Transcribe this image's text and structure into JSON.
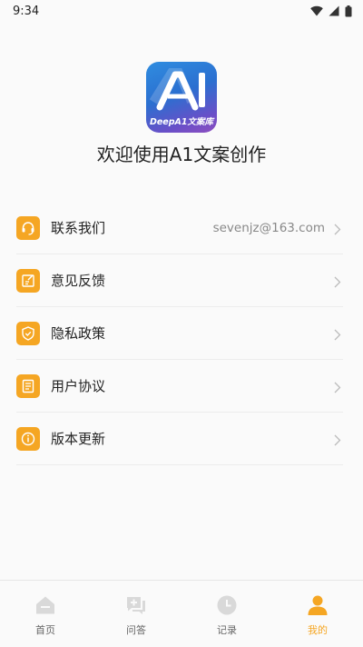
{
  "status_bar": {
    "time": "9:34",
    "icons": [
      "wifi-icon",
      "signal-icon",
      "battery-icon"
    ]
  },
  "app": {
    "logo_text": "DeepA1文案库",
    "welcome": "欢迎使用A1文案创作"
  },
  "menu": {
    "items": [
      {
        "label": "联系我们",
        "value": "sevenjz@163.com",
        "icon": "headset-icon"
      },
      {
        "label": "意见反馈",
        "value": "",
        "icon": "feedback-edit-icon"
      },
      {
        "label": "隐私政策",
        "value": "",
        "icon": "shield-check-icon"
      },
      {
        "label": "用户协议",
        "value": "",
        "icon": "document-icon"
      },
      {
        "label": "版本更新",
        "value": "",
        "icon": "info-icon"
      }
    ]
  },
  "tabs": [
    {
      "label": "首页",
      "icon": "home-icon",
      "active": false
    },
    {
      "label": "问答",
      "icon": "chat-plus-icon",
      "active": false
    },
    {
      "label": "记录",
      "icon": "clock-icon",
      "active": false
    },
    {
      "label": "我的",
      "icon": "user-icon",
      "active": true
    }
  ],
  "colors": {
    "accent": "#f5a623",
    "inactive_icon": "#d9d9d9",
    "background": "#fafafa"
  }
}
